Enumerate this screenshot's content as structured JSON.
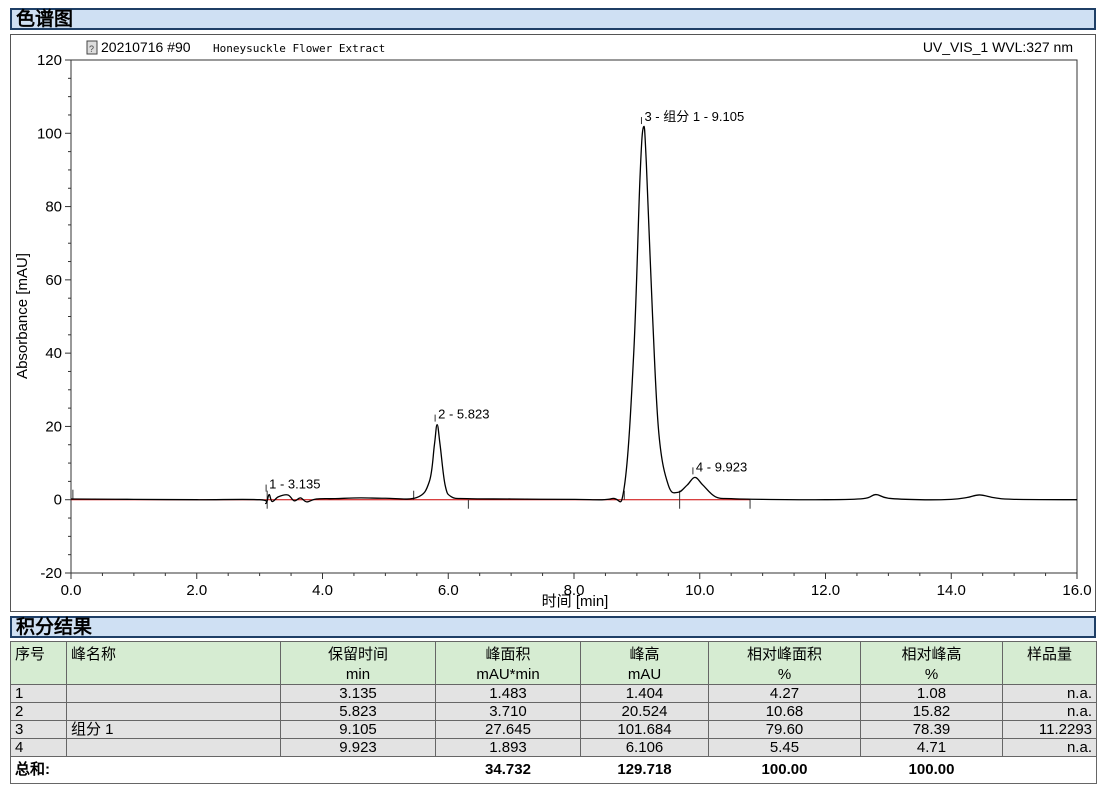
{
  "chromatogram_header": "色谱图",
  "integration_header": "积分结果",
  "sample_title": "20210716 #90",
  "sample_name": "Honeysuckle Flower Extract",
  "detector": "UV_VIS_1 WVL:327 nm",
  "chart_data": {
    "type": "line",
    "xlabel": "时间 [min]",
    "ylabel": "Absorbance [mAU]",
    "xlim": [
      0,
      16
    ],
    "ylim": [
      -20,
      120
    ],
    "xticks": [
      "0.0",
      "2.0",
      "4.0",
      "6.0",
      "8.0",
      "10.0",
      "12.0",
      "14.0",
      "16.0"
    ],
    "yticks": [
      "-20",
      "0",
      "20",
      "40",
      "60",
      "80",
      "100",
      "120"
    ],
    "line_color": "#000000",
    "baseline_color": "#cc0000",
    "baseline_range": [
      0,
      10.8
    ],
    "x": [
      0.0,
      1.0,
      2.0,
      3.0,
      3.1,
      3.15,
      3.2,
      3.3,
      3.45,
      3.55,
      3.65,
      3.75,
      3.9,
      4.2,
      4.6,
      5.0,
      5.5,
      5.7,
      5.78,
      5.823,
      5.87,
      5.95,
      6.05,
      6.3,
      7.0,
      8.0,
      8.6,
      8.8,
      8.95,
      9.05,
      9.105,
      9.15,
      9.25,
      9.35,
      9.5,
      9.65,
      9.8,
      9.923,
      10.05,
      10.25,
      10.5,
      11.0,
      12.0,
      12.6,
      12.8,
      13.0,
      13.5,
      14.0,
      14.25,
      14.45,
      14.7,
      15.0,
      16.0
    ],
    "y": [
      0.2,
      0.1,
      0.0,
      0.0,
      -1.0,
      1.4,
      -0.5,
      0.8,
      1.3,
      -0.3,
      0.5,
      -0.6,
      0.2,
      0.3,
      0.5,
      0.4,
      0.6,
      5.0,
      15.0,
      20.5,
      15.0,
      4.0,
      0.8,
      0.3,
      0.2,
      0.1,
      0.3,
      3.5,
      40.0,
      88.0,
      101.7,
      92.0,
      50.0,
      18.0,
      4.0,
      2.0,
      4.0,
      6.1,
      4.0,
      0.8,
      0.3,
      0.1,
      0.0,
      0.3,
      1.4,
      0.4,
      0.0,
      0.1,
      0.6,
      1.3,
      0.5,
      0.1,
      0.0
    ],
    "peak_labels": [
      {
        "text": "1 - 3.135",
        "x": 3.135,
        "y": 1.4
      },
      {
        "text": "2 - 5.823",
        "x": 5.823,
        "y": 20.5
      },
      {
        "text": "3 - 组分 1 - 9.105",
        "x": 9.105,
        "y": 101.7
      },
      {
        "text": "4 - 9.923",
        "x": 9.923,
        "y": 6.1
      }
    ],
    "integration_markers": [
      {
        "x": 3.12,
        "dir": "both"
      },
      {
        "x": 5.45,
        "dir": "up"
      },
      {
        "x": 6.32,
        "dir": "down"
      },
      {
        "x": 8.8,
        "dir": "up"
      },
      {
        "x": 9.68,
        "dir": "both"
      },
      {
        "x": 10.8,
        "dir": "down"
      }
    ]
  },
  "table": {
    "headers": [
      "序号",
      "峰名称",
      "保留时间",
      "峰面积",
      "峰高",
      "相对峰面积",
      "相对峰高",
      "样品量"
    ],
    "units": [
      "",
      "",
      "min",
      "mAU*min",
      "mAU",
      "%",
      "%",
      ""
    ],
    "rows": [
      [
        "1",
        "",
        "3.135",
        "1.483",
        "1.404",
        "4.27",
        "1.08",
        "n.a."
      ],
      [
        "2",
        "",
        "5.823",
        "3.710",
        "20.524",
        "10.68",
        "15.82",
        "n.a."
      ],
      [
        "3",
        "组分 1",
        "9.105",
        "27.645",
        "101.684",
        "79.60",
        "78.39",
        "11.2293"
      ],
      [
        "4",
        "",
        "9.923",
        "1.893",
        "6.106",
        "5.45",
        "4.71",
        "n.a."
      ]
    ],
    "totals": [
      "总和:",
      "",
      "",
      "34.732",
      "129.718",
      "100.00",
      "100.00",
      ""
    ]
  }
}
